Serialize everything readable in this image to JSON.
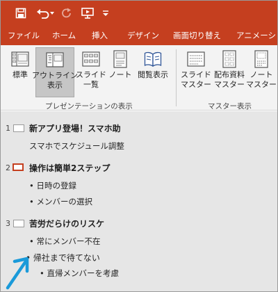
{
  "ribbon_tabs": [
    {
      "label": "ファイル"
    },
    {
      "label": "ホーム"
    },
    {
      "label": "挿入"
    },
    {
      "label": "デザイン"
    },
    {
      "label": "画面切り替え"
    },
    {
      "label": "アニメーション"
    }
  ],
  "view_group": {
    "label": "プレゼンテーションの表示",
    "buttons": [
      {
        "label": "標準"
      },
      {
        "label_line1": "アウトライン",
        "label_line2": "表示",
        "selected": true
      },
      {
        "label_line1": "スライド",
        "label_line2": "一覧"
      },
      {
        "label_line1": "ノート",
        "label_line2": ""
      },
      {
        "label": "閲覧表示"
      }
    ]
  },
  "master_group": {
    "label": "マスター表示",
    "buttons": [
      {
        "label_line1": "スライド",
        "label_line2": "マスター"
      },
      {
        "label_line1": "配布資料",
        "label_line2": "マスター"
      },
      {
        "label_line1": "ノート",
        "label_line2": "マスター"
      }
    ]
  },
  "outline": {
    "slides": [
      {
        "number": "1",
        "title": "新アプリ登場！スマホ助",
        "items": [
          {
            "text": "スマホでスケジュール調整"
          }
        ]
      },
      {
        "number": "2",
        "title": "操作は簡単2ステップ",
        "current": true,
        "items": [
          {
            "text": "• 日時の登録"
          },
          {
            "text": "• メンバーの選択"
          }
        ]
      },
      {
        "number": "3",
        "title": "苦労だらけのリスケ",
        "items": [
          {
            "text": "• 常にメンバー不在"
          },
          {
            "text": "• 帰社まで待てない"
          },
          {
            "text": "• 直帰メンバーを考慮"
          }
        ]
      }
    ]
  },
  "colors": {
    "accent": "#c53f1f",
    "ribbon_bg": "#f3f3f3",
    "outline_bg": "#e6e6e6",
    "pointer_arrow": "#1a9ad9"
  },
  "icons": [
    "save-icon",
    "undo-icon",
    "redo-icon",
    "slideshow-from-start-icon",
    "customize-toolbar-icon",
    "cursor-pointer-arrow"
  ]
}
